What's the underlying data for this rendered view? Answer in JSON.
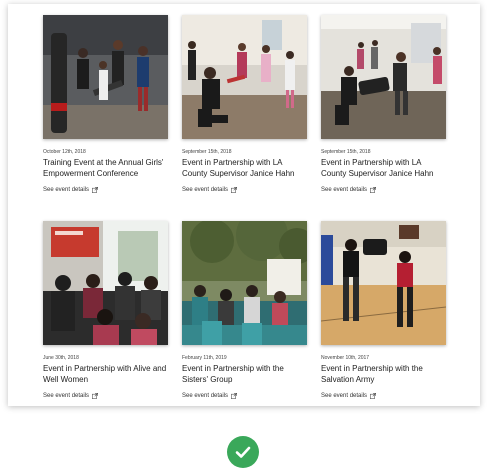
{
  "events": [
    {
      "date": "October 12th, 2018",
      "title": "Training Event at the Annual Girls' Empowerment Conference",
      "link": "See event details"
    },
    {
      "date": "September 15th, 2018",
      "title": "Event in Partnership with LA County Supervisor Janice Hahn",
      "link": "See event details"
    },
    {
      "date": "September 15th, 2018",
      "title": "Event in Partnership with LA County Supervisor Janice Hahn",
      "link": "See event details"
    },
    {
      "date": "June 30th, 2018",
      "title": "Event in Partnership with Alive and Well Women",
      "link": "See event details"
    },
    {
      "date": "February 11th, 2019",
      "title": "Event in Partnership with the Sisters' Group",
      "link": "See event details"
    },
    {
      "date": "November 10th, 2017",
      "title": "Event in Partnership with the Salvation Army",
      "link": "See event details"
    }
  ],
  "icons": {
    "external": "external-link-icon",
    "success": "check-circle-icon"
  },
  "colors": {
    "success": "#3aa85a"
  }
}
